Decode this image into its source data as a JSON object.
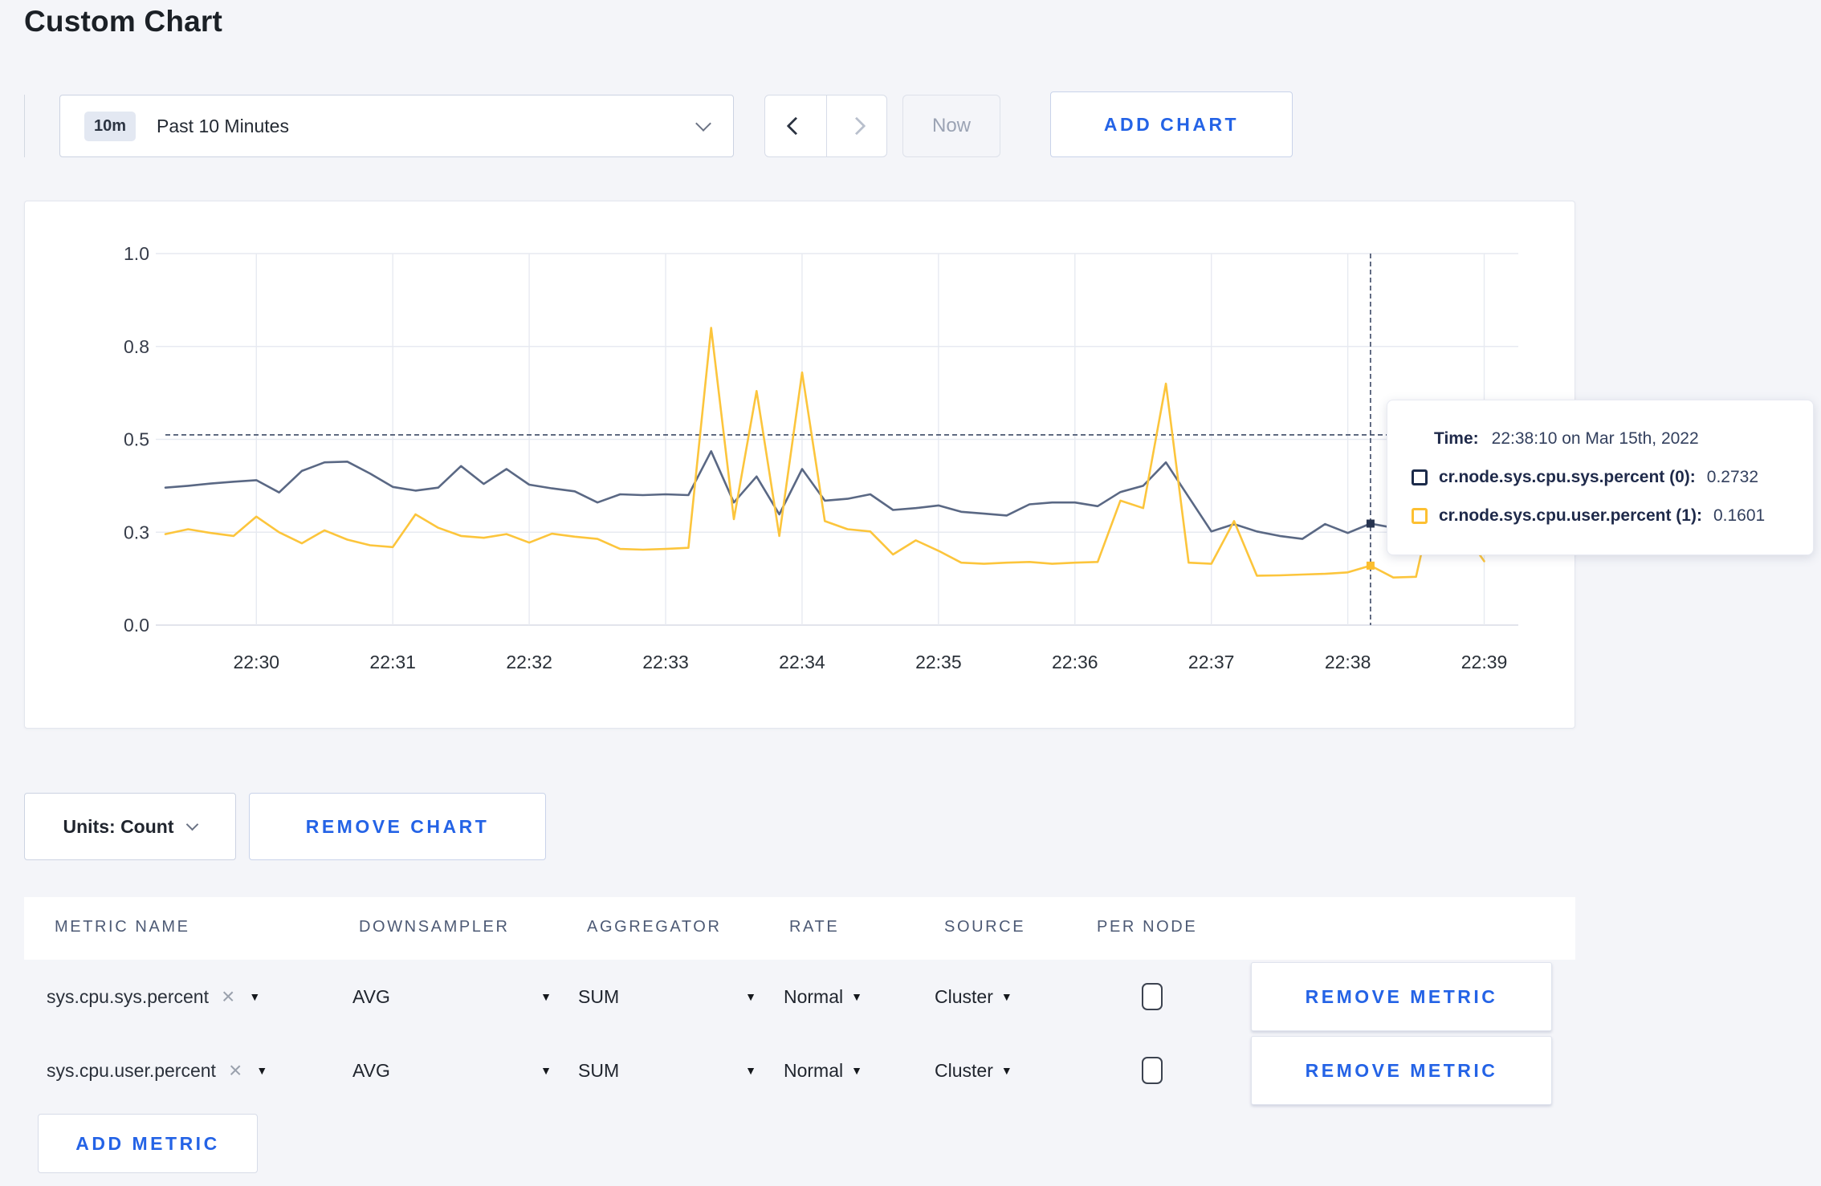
{
  "page": {
    "title": "Custom Chart"
  },
  "toolbar": {
    "timescale": {
      "badge": "10m",
      "label": "Past 10 Minutes"
    },
    "now_label": "Now",
    "add_chart_label": "ADD CHART"
  },
  "chart_data": {
    "type": "line",
    "x_axis": "time",
    "x_ticks": [
      "22:30",
      "22:31",
      "22:32",
      "22:33",
      "22:34",
      "22:35",
      "22:36",
      "22:37",
      "22:38",
      "22:39"
    ],
    "y_ticks": [
      {
        "label": "0.0",
        "value": 0
      },
      {
        "label": "0.3",
        "value": 0.25
      },
      {
        "label": "0.5",
        "value": 0.5
      },
      {
        "label": "0.8",
        "value": 0.75
      },
      {
        "label": "1.0",
        "value": 1
      }
    ],
    "ylim": [
      0,
      1
    ],
    "x_min": -0.6667,
    "x_max": 9.25,
    "x_start": -0.6667,
    "x_step": 0.16667,
    "grid": true,
    "series": [
      {
        "name": "cr.node.sys.cpu.sys.percent (0)",
        "color": "#5a6884",
        "marker_color": "#26334f",
        "swatch_color": "#1c2b4a",
        "values": [
          0.37,
          0.375,
          0.381,
          0.386,
          0.39,
          0.357,
          0.415,
          0.438,
          0.44,
          0.408,
          0.372,
          0.362,
          0.37,
          0.428,
          0.38,
          0.42,
          0.378,
          0.368,
          0.36,
          0.33,
          0.352,
          0.35,
          0.352,
          0.35,
          0.468,
          0.33,
          0.4,
          0.298,
          0.42,
          0.335,
          0.34,
          0.352,
          0.31,
          0.315,
          0.322,
          0.305,
          0.3,
          0.295,
          0.325,
          0.33,
          0.33,
          0.32,
          0.358,
          0.375,
          0.438,
          0.345,
          0.252,
          0.272,
          0.252,
          0.24,
          0.232,
          0.272,
          0.248,
          0.2732,
          0.262,
          0.285,
          0.295,
          0.305,
          0.298
        ]
      },
      {
        "name": "cr.node.sys.cpu.user.percent (1)",
        "color": "#fcc53c",
        "marker_color": "#fcbe2e",
        "swatch_color": "#fdc032",
        "values": [
          0.245,
          0.258,
          0.248,
          0.24,
          0.292,
          0.25,
          0.22,
          0.255,
          0.23,
          0.215,
          0.21,
          0.298,
          0.262,
          0.24,
          0.235,
          0.245,
          0.222,
          0.246,
          0.238,
          0.232,
          0.205,
          0.203,
          0.205,
          0.208,
          0.8,
          0.285,
          0.63,
          0.24,
          0.68,
          0.28,
          0.258,
          0.252,
          0.19,
          0.228,
          0.2,
          0.168,
          0.165,
          0.168,
          0.17,
          0.165,
          0.168,
          0.17,
          0.335,
          0.315,
          0.65,
          0.168,
          0.165,
          0.28,
          0.133,
          0.134,
          0.136,
          0.138,
          0.142,
          0.1601,
          0.128,
          0.13,
          0.4,
          0.26,
          0.172
        ]
      }
    ],
    "hover": {
      "time_min": 8.1667,
      "cursor_value": 0.512,
      "values": [
        0.2732,
        0.1601
      ]
    }
  },
  "tooltip": {
    "time_label": "Time:",
    "time_value": "22:38:10 on Mar 15th, 2022",
    "series": [
      {
        "label": "cr.node.sys.cpu.sys.percent (0):",
        "value": "0.2732"
      },
      {
        "label": "cr.node.sys.cpu.user.percent (1):",
        "value": "0.1601"
      }
    ]
  },
  "chart_footer": {
    "units_label": "Units: Count",
    "remove_chart_label": "REMOVE CHART"
  },
  "table": {
    "headers": [
      "METRIC NAME",
      "DOWNSAMPLER",
      "AGGREGATOR",
      "RATE",
      "SOURCE",
      "PER NODE"
    ],
    "rows": [
      {
        "metric": "sys.cpu.sys.percent",
        "downsampler": "AVG",
        "aggregator": "SUM",
        "rate": "Normal",
        "source": "Cluster",
        "per_node_checked": false,
        "remove_label": "REMOVE METRIC"
      },
      {
        "metric": "sys.cpu.user.percent",
        "downsampler": "AVG",
        "aggregator": "SUM",
        "rate": "Normal",
        "source": "Cluster",
        "per_node_checked": false,
        "remove_label": "REMOVE METRIC"
      }
    ],
    "add_metric_label": "ADD METRIC"
  }
}
